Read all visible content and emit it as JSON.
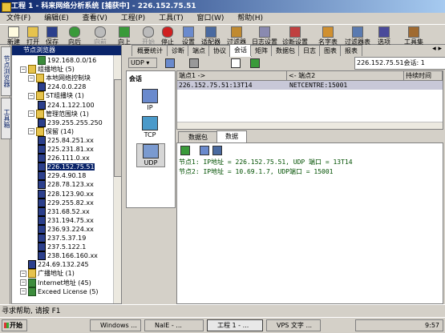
{
  "window": {
    "title": "工程 1 - 科来网络分析系统 [捕获中] - 226.152.75.51"
  },
  "menu": [
    "文件(F)",
    "编辑(E)",
    "查看(V)",
    "工程(P)",
    "工具(T)",
    "窗口(W)",
    "帮助(H)"
  ],
  "toolbar": [
    {
      "label": "新建",
      "icon": "new-icon",
      "enabled": true
    },
    {
      "label": "打开",
      "icon": "open-icon",
      "enabled": true
    },
    {
      "label": "保存",
      "icon": "save-icon",
      "enabled": true
    },
    {
      "label": "向后",
      "icon": "back-icon",
      "enabled": true
    },
    {
      "label": "向前",
      "icon": "forward-icon",
      "enabled": false
    },
    {
      "label": "向上",
      "icon": "up-icon",
      "enabled": true
    },
    {
      "label": "开始",
      "icon": "start-icon",
      "enabled": false
    },
    {
      "label": "停止",
      "icon": "stop-icon",
      "enabled": true
    },
    {
      "label": "设置",
      "icon": "settings-icon",
      "enabled": true
    },
    {
      "label": "适配器",
      "icon": "adapter-icon",
      "enabled": true
    },
    {
      "label": "过滤器",
      "icon": "filter-icon",
      "enabled": true
    },
    {
      "label": "日志设置",
      "icon": "log-settings-icon",
      "enabled": true
    },
    {
      "label": "诊断设置",
      "icon": "diag-settings-icon",
      "enabled": true
    },
    {
      "label": "名字表",
      "icon": "names-icon",
      "enabled": true
    },
    {
      "label": "过滤器表",
      "icon": "filter-table-icon",
      "enabled": true
    },
    {
      "label": "选项",
      "icon": "options-icon",
      "enabled": true
    },
    {
      "label": "工具集",
      "icon": "toolset-icon",
      "enabled": true
    }
  ],
  "left_tabs": [
    "节点浏览器",
    "工具箱"
  ],
  "tree": {
    "header": "节点浏览器",
    "nodes": [
      {
        "text": "192.168.0.0/16",
        "level": 3,
        "type": "net"
      },
      {
        "text": "组播地址 (5)",
        "level": 1,
        "type": "folder"
      },
      {
        "text": "本地网络控制块",
        "level": 2,
        "type": "folder"
      },
      {
        "text": "224.0.0.228",
        "level": 3,
        "type": "host"
      },
      {
        "text": "ST组播块 (1)",
        "level": 2,
        "type": "folder"
      },
      {
        "text": "224.1.122.100",
        "level": 3,
        "type": "host"
      },
      {
        "text": "管理范围块 (1)",
        "level": 2,
        "type": "folder"
      },
      {
        "text": "239.255.255.250",
        "level": 3,
        "type": "host"
      },
      {
        "text": "保留 (14)",
        "level": 2,
        "type": "folder"
      },
      {
        "text": "225.84.251.xx",
        "level": 3,
        "type": "host"
      },
      {
        "text": "225.231.81.xx",
        "level": 3,
        "type": "host"
      },
      {
        "text": "226.111.0.xx",
        "level": 3,
        "type": "host"
      },
      {
        "text": "226.152.75.51",
        "level": 3,
        "type": "host",
        "selected": true
      },
      {
        "text": "229.4.90.18",
        "level": 3,
        "type": "host"
      },
      {
        "text": "228.78.123.xx",
        "level": 3,
        "type": "host"
      },
      {
        "text": "228.123.90.xx",
        "level": 3,
        "type": "host"
      },
      {
        "text": "229.255.82.xx",
        "level": 3,
        "type": "host"
      },
      {
        "text": "231.68.52.xx",
        "level": 3,
        "type": "host"
      },
      {
        "text": "231.194.75.xx",
        "level": 3,
        "type": "host"
      },
      {
        "text": "236.93.224.xx",
        "level": 3,
        "type": "host"
      },
      {
        "text": "237.5.37.19",
        "level": 3,
        "type": "host"
      },
      {
        "text": "237.5.122.1",
        "level": 3,
        "type": "host"
      },
      {
        "text": "238.166.160.xx",
        "level": 3,
        "type": "host"
      },
      {
        "text": "224.69.132.245",
        "level": 2,
        "type": "host"
      },
      {
        "text": "广播地址 (1)",
        "level": 1,
        "type": "folder"
      },
      {
        "text": "Internet地址 (45)",
        "level": 1,
        "type": "net"
      },
      {
        "text": "Exceed License (5)",
        "level": 1,
        "type": "net"
      }
    ]
  },
  "tabs": [
    "概要统计",
    "诊断",
    "端点",
    "协议",
    "会话",
    "矩阵",
    "数据包",
    "日志",
    "图表",
    "报表"
  ],
  "active_tab": "会话",
  "subtoolbar": {
    "protocol": "UDP",
    "session_label": "226.152.75.51会话: 1"
  },
  "session_types": [
    {
      "label": "IP",
      "selected": false
    },
    {
      "label": "TCP",
      "selected": false
    },
    {
      "label": "UDP",
      "selected": true
    }
  ],
  "session_panel_title": "会话",
  "grid": {
    "columns": [
      "端点1 ->",
      "<- 端点2",
      "持续时间"
    ],
    "rows": [
      [
        "226.152.75.51:13T14",
        "NETCENTRE:15001",
        ""
      ]
    ]
  },
  "detail_tabs": [
    "数据包",
    "数据"
  ],
  "detail_lines": [
    "节点1: IP地址 = 226.152.75.51, UDP 端口 = 13T14",
    "节点2: IP地址 = 10.69.1.7, UDP端口 = 15001"
  ],
  "status": "寻求帮助, 请按 F1",
  "taskbar": {
    "start": "开始",
    "tasks": [
      "Windows ...",
      "NaIE - ...",
      "工程 1 - ...",
      "VPS 文字 ..."
    ],
    "clock": "9:57"
  }
}
